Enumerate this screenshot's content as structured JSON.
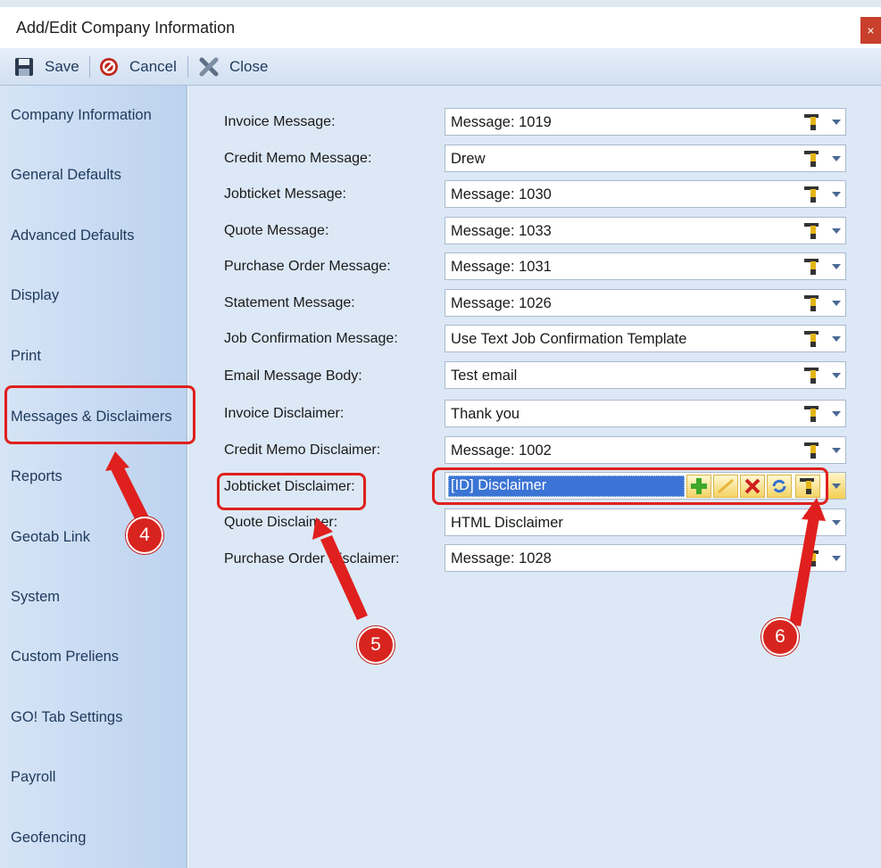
{
  "window": {
    "title": "Add/Edit Company Information",
    "close_glyph": "×"
  },
  "toolbar": {
    "save_label": "Save",
    "cancel_label": "Cancel",
    "close_label": "Close",
    "icons": [
      "floppy-disk-icon",
      "cancel-circle-icon",
      "close-x-icon"
    ]
  },
  "sidebar": {
    "items": [
      {
        "label": "Company Information"
      },
      {
        "label": "General Defaults"
      },
      {
        "label": "Advanced Defaults"
      },
      {
        "label": "Display"
      },
      {
        "label": "Print"
      },
      {
        "label": "Messages & Disclaimers",
        "selected": true
      },
      {
        "label": "Reports"
      },
      {
        "label": "Geotab Link"
      },
      {
        "label": "System"
      },
      {
        "label": "Custom Preliens"
      },
      {
        "label": "GO! Tab Settings"
      },
      {
        "label": "Payroll"
      },
      {
        "label": "Geofencing"
      }
    ]
  },
  "form": {
    "rows": [
      {
        "label": "Invoice Message:",
        "value": "Message: 1019"
      },
      {
        "label": "Credit Memo Message:",
        "value": "Drew"
      },
      {
        "label": "Jobticket Message:",
        "value": "Message: 1030"
      },
      {
        "label": "Quote Message:",
        "value": "Message: 1033"
      },
      {
        "label": "Purchase Order Message:",
        "value": "Message: 1031"
      },
      {
        "label": "Statement Message:",
        "value": "Message: 1026"
      },
      {
        "label": "Job Confirmation Message:",
        "value": "Use Text Job Confirmation Template"
      },
      {
        "label": "Email Message Body:",
        "value": "Test email"
      },
      {
        "label": "Invoice Disclaimer:",
        "value": "Thank you"
      },
      {
        "label": "Credit Memo Disclaimer:",
        "value": "Message: 1002"
      },
      {
        "label": "Jobticket Disclaimer:",
        "value": "[ID] Disclaimer",
        "active": true
      },
      {
        "label": "Quote Disclaimer:",
        "value": "HTML Disclaimer"
      },
      {
        "label": "Purchase Order Disclaimer:",
        "value": "Message: 1028"
      }
    ],
    "active_row_buttons": [
      "add-icon",
      "edit-icon",
      "delete-icon",
      "refresh-icon",
      "tools-icon"
    ]
  },
  "annotations": {
    "badges": [
      "4",
      "5",
      "6"
    ],
    "color": "#e0201e"
  },
  "colors": {
    "accent_selection": "#3b74d4",
    "sidebar_text": "#1e395b",
    "annotation_red": "#d8241f"
  }
}
